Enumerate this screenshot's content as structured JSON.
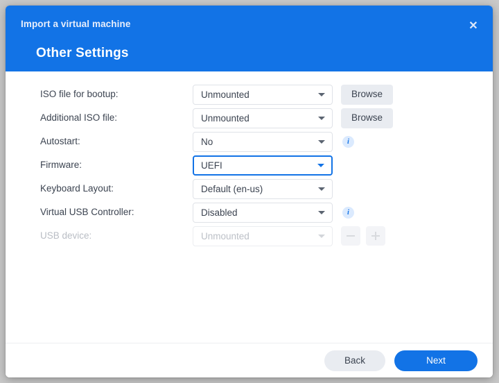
{
  "window": {
    "title": "Import a virtual machine",
    "subtitle": "Other Settings",
    "close_label": "✕",
    "header_color": "#1273e6"
  },
  "form": {
    "rows": [
      {
        "label": "ISO file for bootup:",
        "value": "Unmounted",
        "control": "select",
        "disabled": false,
        "focused": false,
        "trailing": "browse",
        "browse_label": "Browse"
      },
      {
        "label": "Additional ISO file:",
        "value": "Unmounted",
        "control": "select",
        "disabled": false,
        "focused": false,
        "trailing": "browse",
        "browse_label": "Browse"
      },
      {
        "label": "Autostart:",
        "value": "No",
        "control": "select",
        "disabled": false,
        "focused": false,
        "trailing": "info",
        "info_label": "i"
      },
      {
        "label": "Firmware:",
        "value": "UEFI",
        "control": "select",
        "disabled": false,
        "focused": true,
        "trailing": "none"
      },
      {
        "label": "Keyboard Layout:",
        "value": "Default (en-us)",
        "control": "select",
        "disabled": false,
        "focused": false,
        "trailing": "none"
      },
      {
        "label": "Virtual USB Controller:",
        "value": "Disabled",
        "control": "select",
        "disabled": false,
        "focused": false,
        "trailing": "info",
        "info_label": "i"
      },
      {
        "label": "USB device:",
        "value": "Unmounted",
        "control": "select",
        "disabled": true,
        "focused": false,
        "trailing": "stepper",
        "minus_label": "−",
        "plus_label": "+"
      }
    ]
  },
  "footer": {
    "back_label": "Back",
    "next_label": "Next",
    "next_color": "#1273e6"
  }
}
